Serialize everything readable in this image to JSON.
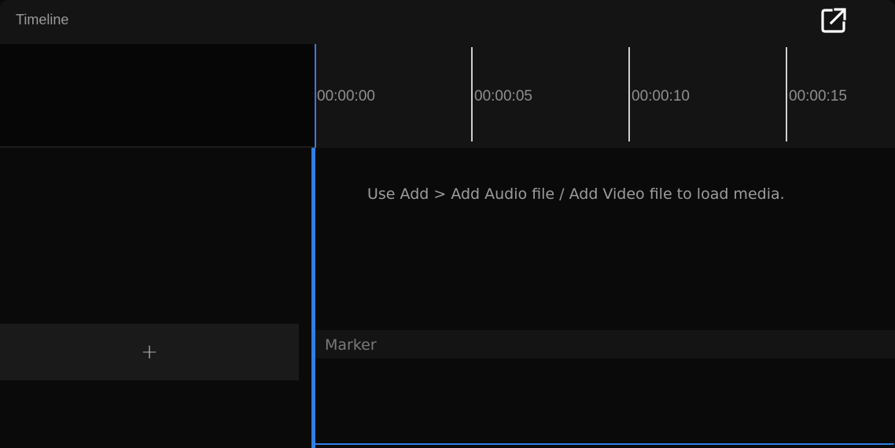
{
  "panel": {
    "title": "Timeline",
    "popout_icon": "external-link-icon"
  },
  "ruler": {
    "ticks": [
      "00:00:00",
      "00:00:05",
      "00:00:10",
      "00:00:15"
    ]
  },
  "tracks": {
    "empty_message": "Use Add > Add Audio file / Add Video file to load media.",
    "add_track_label": "+",
    "marker_label": "Marker"
  },
  "colors": {
    "accent": "#2f7fe8",
    "background": "#0a0a0a",
    "header": "#141414"
  }
}
